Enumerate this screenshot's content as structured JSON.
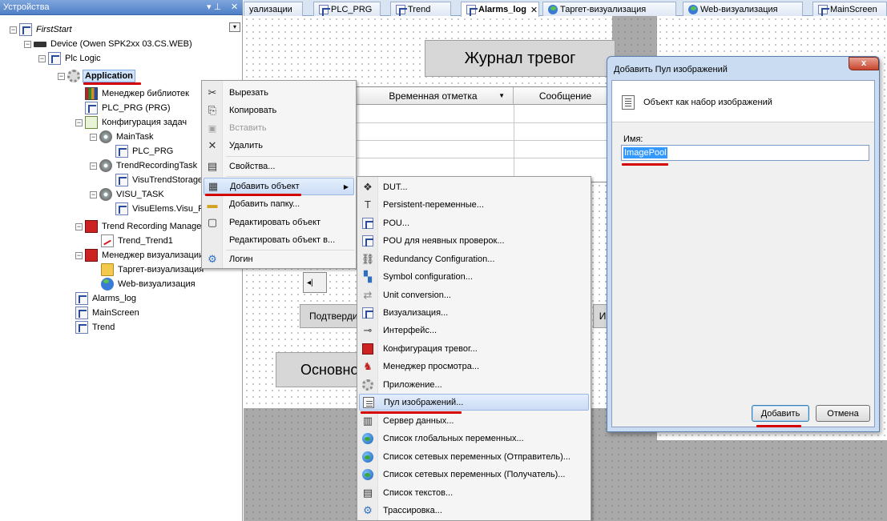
{
  "devices_panel": {
    "title": "Устройства",
    "pin_glyph": "▾ ⊥",
    "close_glyph": "✕",
    "collapse_glyph": "▾",
    "tree": [
      {
        "label": "FirstStart",
        "italic": true
      },
      {
        "label": "Device (Owen SPK2xx 03.CS.WEB)"
      },
      {
        "label": "Plc Logic"
      },
      {
        "label": "Application"
      },
      {
        "label": "Менеджер библиотек"
      },
      {
        "label": "PLC_PRG (PRG)"
      },
      {
        "label": "Конфигурация задач"
      },
      {
        "label": "MainTask"
      },
      {
        "label": "PLC_PRG"
      },
      {
        "label": "TrendRecordingTask"
      },
      {
        "label": "VisuTrendStorage..."
      },
      {
        "label": "VISU_TASK"
      },
      {
        "label": "VisuElems.Visu_Pr"
      },
      {
        "label": "Trend Recording Manager"
      },
      {
        "label": "Trend_Trend1"
      },
      {
        "label": "Менеджер визуализации"
      },
      {
        "label": "Таргет-визуализация"
      },
      {
        "label": "Web-визуализация"
      },
      {
        "label": "Alarms_log"
      },
      {
        "label": "MainScreen"
      },
      {
        "label": "Trend"
      }
    ]
  },
  "tabs": [
    {
      "label": "уализации"
    },
    {
      "label": "PLC_PRG"
    },
    {
      "label": "Trend"
    },
    {
      "label": "Alarms_log",
      "active": true,
      "close": "✕"
    },
    {
      "label": "Таргет-визуализация"
    },
    {
      "label": "Web-визуализация"
    },
    {
      "label": "MainScreen"
    }
  ],
  "visu": {
    "title": "Журнал тревог",
    "col_timestamp": "Временная отметка",
    "col_message": "Сообщение",
    "confirm": "Подтвердит",
    "main": "Основно",
    "i_stub": "И",
    "scroll_stub": "◂|"
  },
  "context_menu": {
    "items": [
      {
        "label": "Вырезать",
        "icon": "✂"
      },
      {
        "label": "Копировать",
        "icon": "⎘"
      },
      {
        "label": "Вставить",
        "icon": "📋",
        "disabled": true
      },
      {
        "label": "Удалить",
        "icon": "✕"
      },
      {
        "label": "Свойства...",
        "icon": "▤"
      },
      {
        "label": "Добавить объект",
        "icon": "▦",
        "highlighted": true,
        "arrow": "▶"
      },
      {
        "label": "Добавить папку...",
        "icon": "▬"
      },
      {
        "label": "Редактировать объект",
        "icon": "▢"
      },
      {
        "label": "Редактировать объект в...",
        "icon": ""
      },
      {
        "label": "Логин",
        "icon": "⚙"
      }
    ]
  },
  "submenu": {
    "items": [
      {
        "label": "DUT..."
      },
      {
        "label": "Persistent-переменные..."
      },
      {
        "label": "POU..."
      },
      {
        "label": "POU для неявных проверок..."
      },
      {
        "label": "Redundancy Configuration..."
      },
      {
        "label": "Symbol configuration..."
      },
      {
        "label": "Unit conversion..."
      },
      {
        "label": "Визуализация..."
      },
      {
        "label": "Интерфейс..."
      },
      {
        "label": "Конфигурация тревог..."
      },
      {
        "label": "Менеджер просмотра..."
      },
      {
        "label": "Приложение..."
      },
      {
        "label": "Пул изображений...",
        "highlighted": true
      },
      {
        "label": "Сервер данных..."
      },
      {
        "label": "Список глобальных переменных..."
      },
      {
        "label": "Список сетевых переменных (Отправитель)..."
      },
      {
        "label": "Список сетевых переменных (Получатель)..."
      },
      {
        "label": "Список текстов..."
      },
      {
        "label": "Трассировка..."
      }
    ]
  },
  "dialog": {
    "title": "Добавить Пул изображений",
    "close": "x",
    "header": "Объект как набор изображений",
    "name_label": "Имя:",
    "name_value": "ImagePool",
    "add_button": "Добавить",
    "cancel_button": "Отмена"
  },
  "colors": {
    "accent_underline": "#d40000",
    "selection_blue": "#3399ff",
    "panel_header": "#4e7fc7"
  }
}
